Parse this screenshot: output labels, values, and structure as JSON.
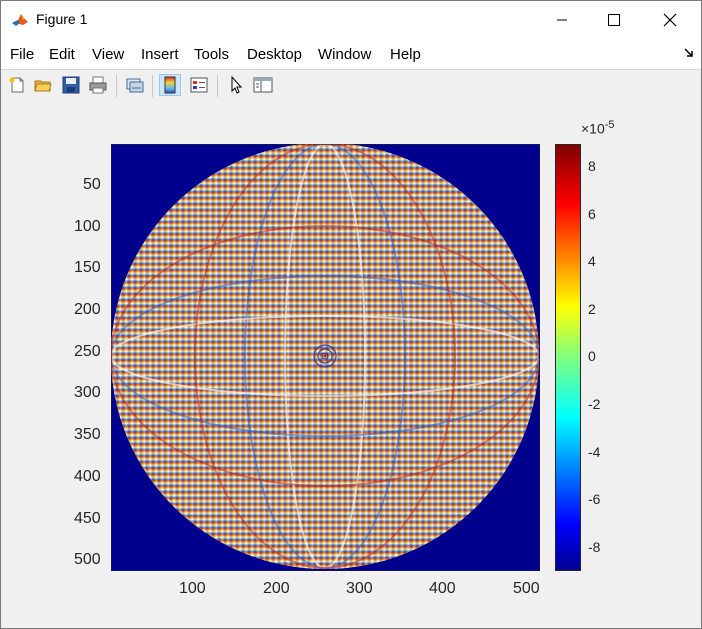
{
  "window": {
    "title": "Figure 1",
    "controls": [
      "minimize",
      "maximize",
      "close"
    ]
  },
  "menu": {
    "items": [
      "File",
      "Edit",
      "View",
      "Insert",
      "Tools",
      "Desktop",
      "Window",
      "Help"
    ]
  },
  "toolbar": {
    "icons": [
      "new-figure-icon",
      "open-file-icon",
      "save-icon",
      "print-icon",
      "link-plot-icon",
      "insert-colorbar-icon",
      "insert-legend-icon",
      "edit-plot-icon",
      "property-inspector-icon"
    ],
    "active": "insert-colorbar-icon"
  },
  "axes": {
    "x_ticks": [
      "100",
      "200",
      "300",
      "400",
      "500"
    ],
    "y_ticks": [
      "50",
      "100",
      "150",
      "200",
      "250",
      "300",
      "350",
      "400",
      "450",
      "500"
    ],
    "xlim": [
      1,
      512
    ],
    "ylim": [
      1,
      512
    ]
  },
  "colorbar": {
    "exponent_label": "×10",
    "exponent_power": "-5",
    "ticks": [
      "8",
      "6",
      "4",
      "2",
      "0",
      "-2",
      "-4",
      "-6",
      "-8"
    ],
    "range": [
      -9,
      9
    ],
    "colormap": "jet"
  },
  "image": {
    "description_type": "imagesc",
    "pattern": "circular aperture with interference fringes",
    "background_color": "#00008f"
  }
}
